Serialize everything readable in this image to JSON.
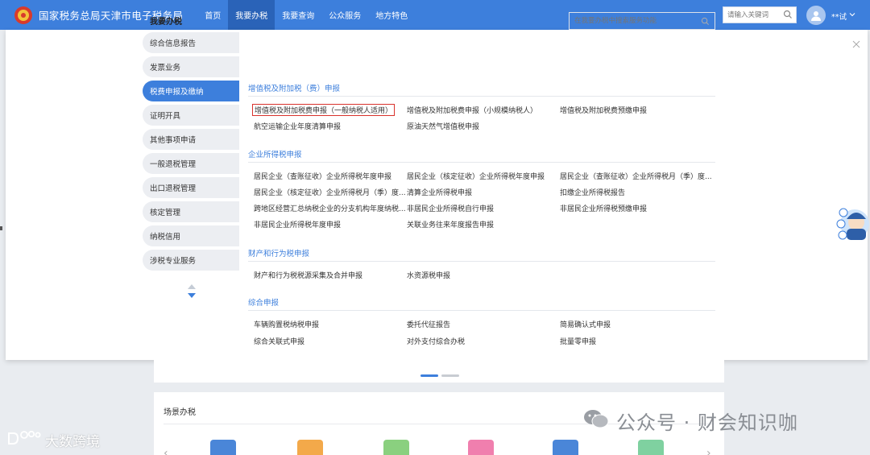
{
  "header": {
    "site_title": "国家税务总局天津市电子税务局",
    "nav": [
      {
        "label": "首页",
        "active": false
      },
      {
        "label": "我要办税",
        "active": true
      },
      {
        "label": "我要查询",
        "active": false
      },
      {
        "label": "公众服务",
        "active": false
      },
      {
        "label": "地方特色",
        "active": false
      }
    ],
    "search_placeholder": "请输入关键词",
    "user_name": "**试"
  },
  "sidebar": {
    "title": "我要办税",
    "items": [
      {
        "label": "综合信息报告",
        "active": false
      },
      {
        "label": "发票业务",
        "active": false
      },
      {
        "label": "税费申报及缴纳",
        "active": true
      },
      {
        "label": "证明开具",
        "active": false
      },
      {
        "label": "其他事项申请",
        "active": false
      },
      {
        "label": "一般退税管理",
        "active": false
      },
      {
        "label": "出口退税管理",
        "active": false
      },
      {
        "label": "核定管理",
        "active": false
      },
      {
        "label": "纳税信用",
        "active": false
      },
      {
        "label": "涉税专业服务",
        "active": false
      }
    ]
  },
  "panel": {
    "search_placeholder": "在我要办税中搜索服务功能",
    "sections": [
      {
        "title": "增值税及附加税（费）申报",
        "links": [
          "增值税及附加税费申报（一般纳税人适用）",
          "增值税及附加税费申报（小规模纳税人）",
          "增值税及附加税费预缴申报",
          "航空运输企业年度清算申报",
          "原油天然气增值税申报"
        ]
      },
      {
        "title": "企业所得税申报",
        "links": [
          "居民企业（查账征收）企业所得税年度申报",
          "居民企业（核定征收）企业所得税年度申报",
          "居民企业（查账征收）企业所得税月（季）度...",
          "居民企业（核定征收）企业所得税月（季）度...",
          "清算企业所得税申报",
          "扣缴企业所得税报告",
          "跨地区经营汇总纳税企业的分支机构年度纳税...",
          "非居民企业所得税自行申报",
          "非居民企业所得税预缴申报",
          "非居民企业所得税年度申报",
          "关联业务往来年度报告申报"
        ]
      },
      {
        "title": "财产和行为税申报",
        "links": [
          "财产和行为税税源采集及合并申报",
          "水资源税申报"
        ]
      },
      {
        "title": "综合申报",
        "links": [
          "车辆购置税纳税申报",
          "委托代征报告",
          "简易确认式申报",
          "综合关联式申报",
          "对外支付综合办税",
          "批量零申报"
        ]
      }
    ]
  },
  "scene": {
    "title": "场景办税"
  },
  "watermarks": {
    "right": "公众号 · 财会知识咖",
    "left": "大数跨境"
  },
  "colors": {
    "primary": "#3d7fdc",
    "nav_active": "#2a63b8",
    "highlight_box": "#d9322c"
  }
}
